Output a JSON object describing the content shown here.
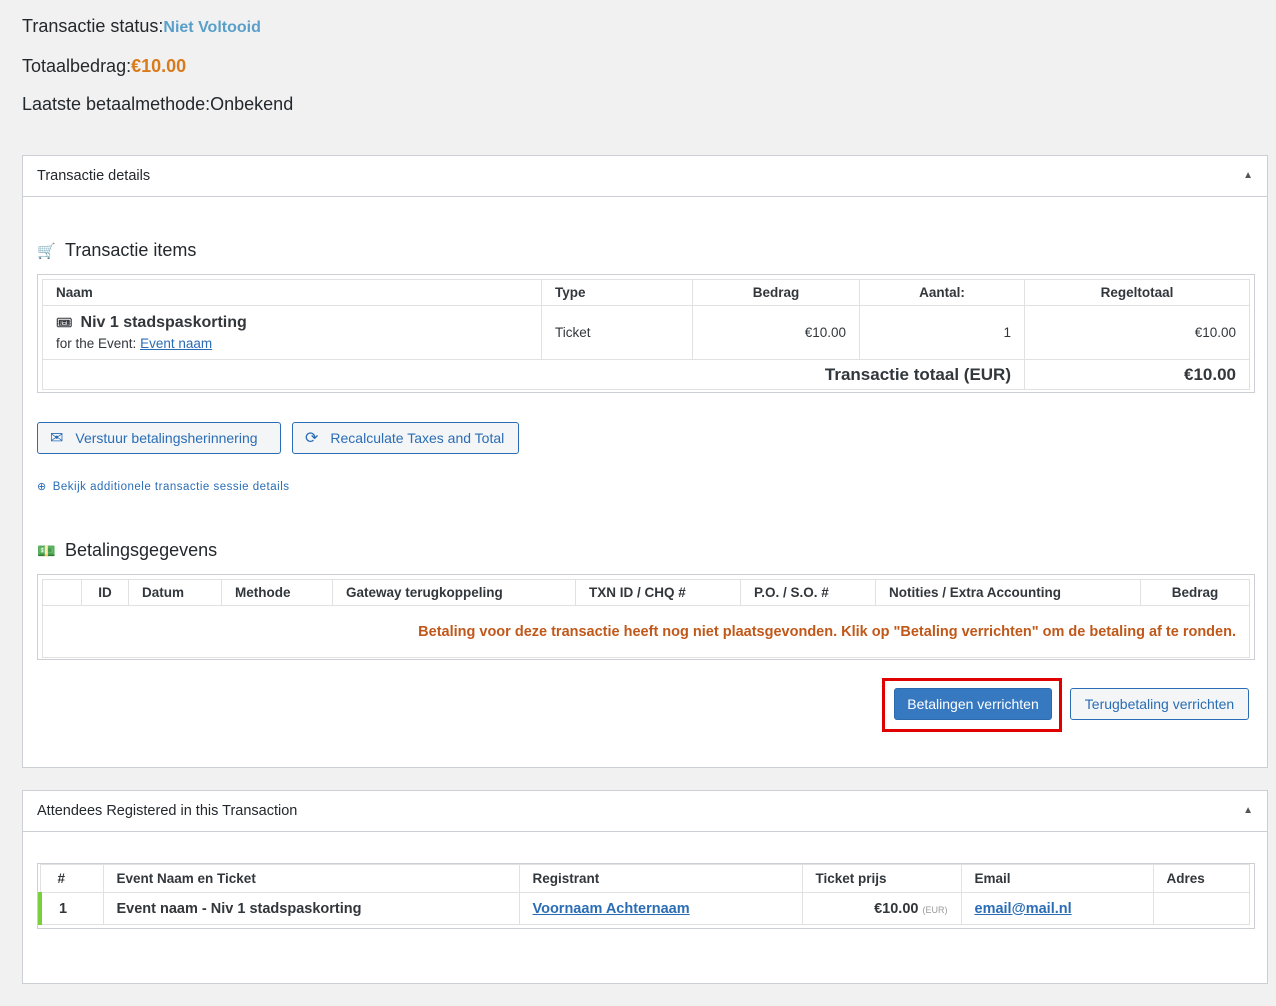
{
  "summary": {
    "status_label": "Transactie status:",
    "status_value": "Niet Voltooid",
    "total_label": "Totaalbedrag:",
    "total_value": "€10.00",
    "method_label": "Laatste betaalmethode:",
    "method_value": "Onbekend"
  },
  "details_box": {
    "title": "Transactie details",
    "items_title": "Transactie items",
    "items_headers": [
      "Naam",
      "Type",
      "Bedrag",
      "Aantal:",
      "Regeltotaal"
    ],
    "item": {
      "name": "Niv 1 stadspaskorting",
      "event_prefix": "for the Event:",
      "event_link": "Event naam",
      "type": "Ticket",
      "amount": "€10.00",
      "qty": "1",
      "line_total": "€10.00"
    },
    "total_label": "Transactie totaal (EUR)",
    "total_value": "€10.00",
    "reminder_button": "Verstuur betalingsherinnering",
    "recalc_button": "Recalculate Taxes and Total",
    "session_link": "Bekijk additionele transactie sessie details",
    "payments_title": "Betalingsgegevens",
    "payments_headers": [
      "",
      "ID",
      "Datum",
      "Methode",
      "Gateway terugkoppeling",
      "TXN ID / CHQ #",
      "P.O. / S.O. #",
      "Notities / Extra Accounting",
      "Bedrag"
    ],
    "no_payment_msg": "Betaling voor deze transactie heeft nog niet plaatsgevonden. Klik op \"Betaling verrichten\" om de betaling af te ronden.",
    "pay_button": "Betalingen verrichten",
    "refund_button": "Terugbetaling verrichten"
  },
  "attendees_box": {
    "title": "Attendees Registered in this Transaction",
    "headers": [
      "#",
      "Event Naam en Ticket",
      "Registrant",
      "Ticket prijs",
      "Email",
      "Adres"
    ],
    "row": {
      "num": "1",
      "event_ticket": "Event naam - Niv 1 stadspaskorting",
      "registrant": "Voornaam Achternaam",
      "price": "€10.00",
      "currency": "(EUR)",
      "email": "email@mail.nl",
      "address": ""
    }
  },
  "colors": {
    "status": "#5a9fc9",
    "amount": "#d97a1b",
    "primary": "#3779c1",
    "warning": "#c0581a",
    "highlight": "#e00000",
    "attendee_bar": "#7ad03a"
  }
}
